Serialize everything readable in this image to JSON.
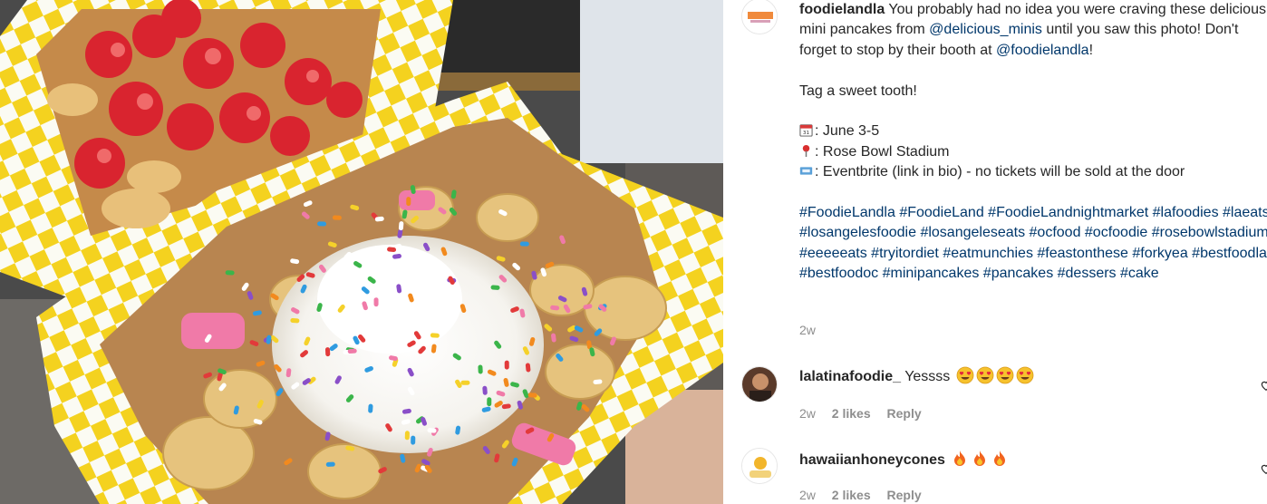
{
  "post": {
    "username": "foodielandla",
    "caption_part1": " You probably had no idea you were craving these delicious mini pancakes from ",
    "mention1": "@delicious_minis",
    "caption_part2": " until you saw this photo! Don't forget to stop by their booth at ",
    "mention2": "@foodielandla",
    "caption_part3": "!",
    "line_tag": "Tag a sweet tooth!",
    "date_line": ": June 3-5",
    "location_line": ": Rose Bowl Stadium",
    "ticket_line": ": Eventbrite (link in bio) - no tickets will be sold at the door",
    "hashtags": "#FoodieLandla #FoodieLand #FoodieLandnightmarket #lafoodies #laeats #losangelesfoodie #losangeleseats #ocfood #ocfoodie #rosebowlstadium #eeeeeats #tryitordiet #eatmunchies #feastonthese #forkyea #bestfoodla #bestfoodoc #minipancakes #pancakes #dessers #cake",
    "time": "2w",
    "icons": [
      "calendar-icon",
      "pin-icon",
      "ticket-icon"
    ]
  },
  "comments": [
    {
      "username": "lalatinafoodie_",
      "text": "Yessss",
      "emojis": [
        "heart-eyes",
        "heart-eyes",
        "heart-eyes",
        "heart-eyes"
      ],
      "time": "2w",
      "likes": "2 likes",
      "reply": "Reply"
    },
    {
      "username": "hawaiianhoneycones",
      "text": "",
      "emojis": [
        "fire",
        "fire",
        "fire"
      ],
      "time": "2w",
      "likes": "2 likes",
      "reply": "Reply"
    }
  ],
  "colors": {
    "link": "#00376b",
    "meta": "#8e8e8e",
    "text": "#262626"
  }
}
